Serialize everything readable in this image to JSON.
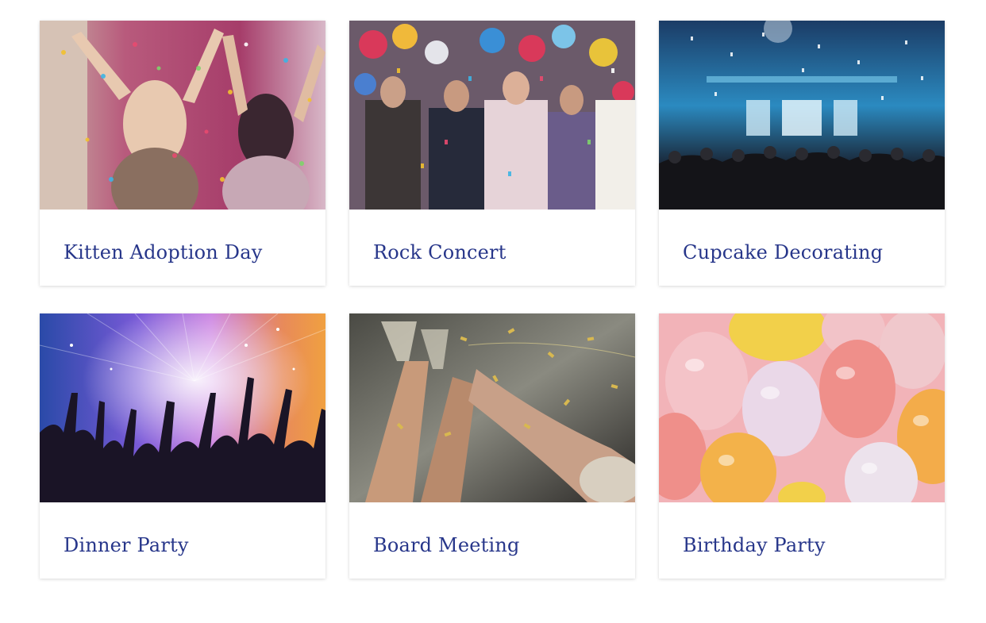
{
  "events": [
    {
      "title": "Kitten Adoption Day",
      "image": "confetti-women-photo"
    },
    {
      "title": "Rock Concert",
      "image": "confetti-crowd-balloons-photo"
    },
    {
      "title": "Cupcake Decorating",
      "image": "nightclub-stage-confetti-photo"
    },
    {
      "title": "Dinner Party",
      "image": "dancing-silhouettes-photo"
    },
    {
      "title": "Board Meeting",
      "image": "champagne-toast-photo"
    },
    {
      "title": "Birthday Party",
      "image": "pastel-balloons-photo"
    }
  ],
  "colors": {
    "title": "#27368a",
    "background": "#ffffff"
  }
}
